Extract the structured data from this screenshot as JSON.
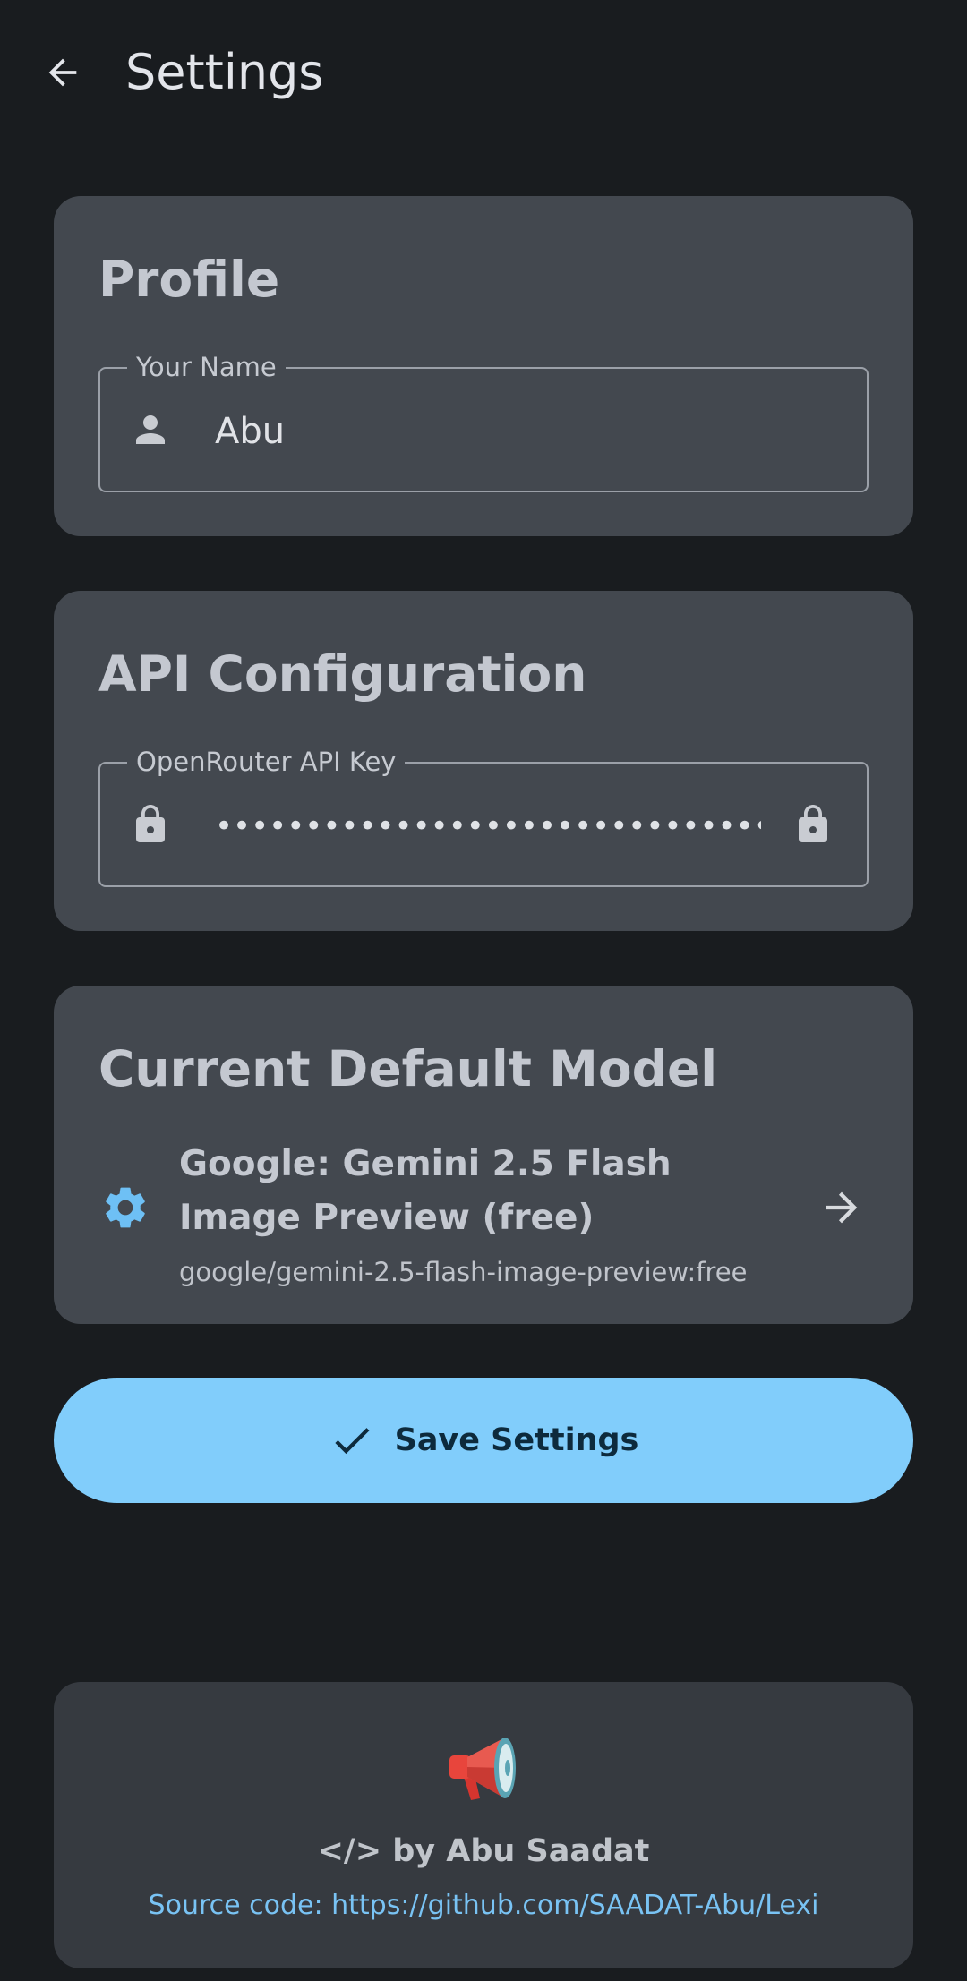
{
  "app_bar": {
    "title": "Settings",
    "back_icon": "arrow-back-icon"
  },
  "profile": {
    "title": "Profile",
    "name_field": {
      "label": "Your Name",
      "value": "Abu",
      "icon": "person-icon"
    }
  },
  "api_config": {
    "title": "API Configuration",
    "key_field": {
      "label": "OpenRouter API Key",
      "masked_value": "••••••••••••••••••••••••••••••••••••••••••",
      "leading_icon": "lock-icon",
      "trailing_icon": "lock-icon"
    }
  },
  "default_model": {
    "title": "Current Default Model",
    "name": "Google: Gemini 2.5 Flash Image Preview (free)",
    "id": "google/gemini-2.5-flash-image-preview:free",
    "leading_icon": "gear-icon",
    "trailing_icon": "arrow-forward-icon"
  },
  "save_button": {
    "label": "Save Settings",
    "icon": "check-icon"
  },
  "footer": {
    "icon": "megaphone-icon",
    "byline": "</> by Abu Saadat",
    "source_link": "Source code: https://github.com/SAADAT-Abu/Lexi"
  },
  "colors": {
    "background": "#191c1f",
    "card": "#43484f",
    "footer_card": "#363a40",
    "accent": "#81cdfb",
    "link": "#79c3f4",
    "icon_accent": "#6ec0f5"
  }
}
